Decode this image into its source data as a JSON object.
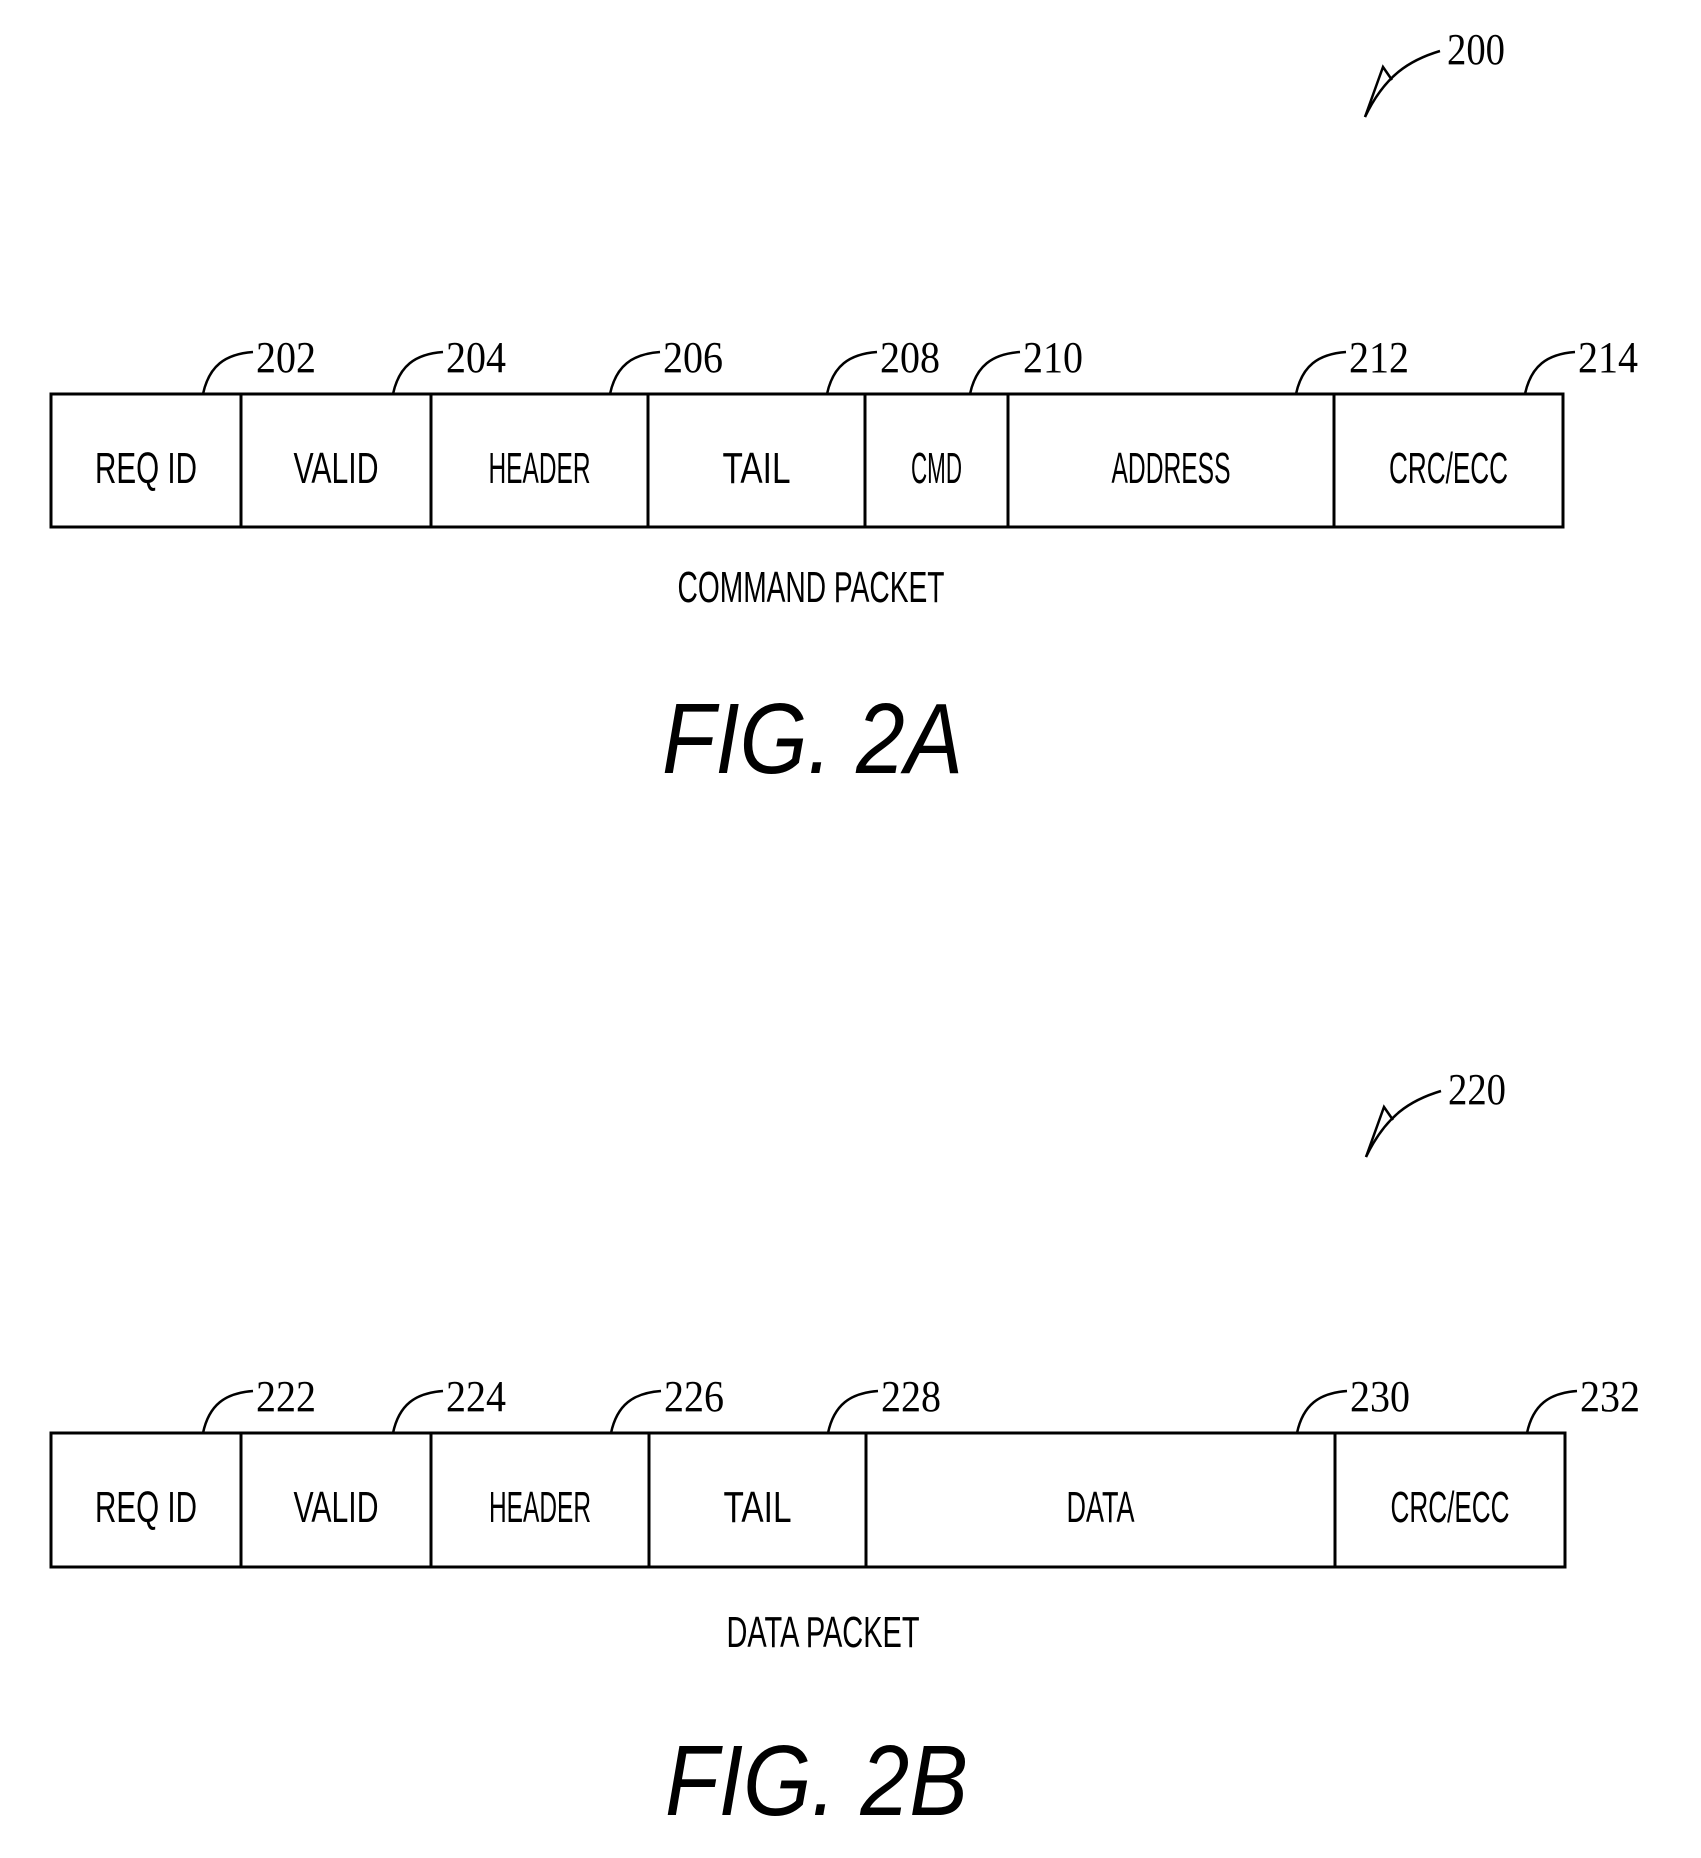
{
  "figures": [
    {
      "id": "fig-2a",
      "figure_label": "FIG. 2A",
      "caption": "COMMAND PACKET",
      "reference": "200",
      "fields": [
        {
          "label": "REQ ID",
          "ref": "202"
        },
        {
          "label": "VALID",
          "ref": "204"
        },
        {
          "label": "HEADER",
          "ref": "206"
        },
        {
          "label": "TAIL",
          "ref": "208"
        },
        {
          "label": "CMD",
          "ref": "210"
        },
        {
          "label": "ADDRESS",
          "ref": "212"
        },
        {
          "label": "CRC/ECC",
          "ref": "214"
        }
      ]
    },
    {
      "id": "fig-2b",
      "figure_label": "FIG. 2B",
      "caption": "DATA PACKET",
      "reference": "220",
      "fields": [
        {
          "label": "REQ ID",
          "ref": "222"
        },
        {
          "label": "VALID",
          "ref": "224"
        },
        {
          "label": "HEADER",
          "ref": "226"
        },
        {
          "label": "TAIL",
          "ref": "228"
        },
        {
          "label": "DATA",
          "ref": "230"
        },
        {
          "label": "CRC/ECC",
          "ref": "232"
        }
      ]
    }
  ]
}
